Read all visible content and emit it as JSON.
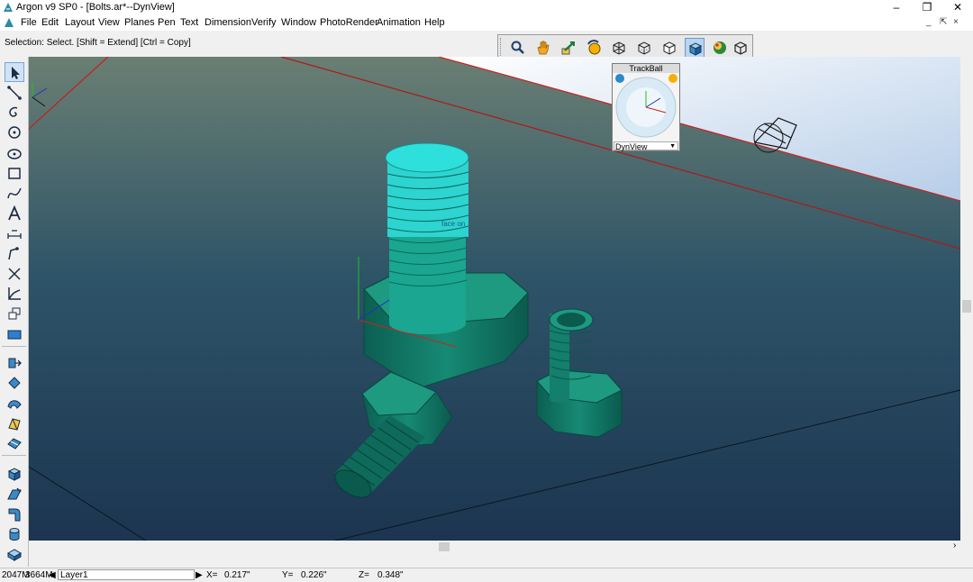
{
  "window": {
    "title": "Argon v9 SP0 - [Bolts.ar*--DynView]"
  },
  "menu": [
    "File",
    "Edit",
    "Layout",
    "View",
    "Planes",
    "Pen",
    "Text",
    "Dimension",
    "Verify",
    "Window",
    "PhotoRender",
    "Animation",
    "Help"
  ],
  "selection_hint": "Selection: Select. [Shift = Extend] [Ctrl = Copy]",
  "view_toolbar": [
    {
      "name": "zoom-icon"
    },
    {
      "name": "pan-hand-icon"
    },
    {
      "name": "zoom-window-icon"
    },
    {
      "name": "rotate-view-icon"
    },
    {
      "name": "wireframe-cube-icon"
    },
    {
      "name": "hidden-line-cube-icon"
    },
    {
      "name": "shaded-cube-icon"
    },
    {
      "name": "smooth-shaded-cube-icon",
      "active": true
    },
    {
      "name": "render-sphere-icon"
    },
    {
      "name": "outline-cube-icon"
    }
  ],
  "left_tools": [
    {
      "name": "select-arrow-icon",
      "active": true
    },
    {
      "name": "line-icon"
    },
    {
      "name": "spiral-icon"
    },
    {
      "name": "circle-icon"
    },
    {
      "name": "ellipse-icon"
    },
    {
      "name": "rectangle-icon"
    },
    {
      "name": "curve-icon"
    },
    {
      "name": "text-icon"
    },
    {
      "name": "dimension-icon"
    },
    {
      "name": "polyline-icon"
    },
    {
      "name": "trim-icon"
    },
    {
      "name": "axis-icon"
    },
    {
      "name": "transform-icon"
    },
    {
      "name": "filled-rectangle-icon"
    },
    {
      "name": "extrude-icon"
    },
    {
      "name": "revolve-icon"
    },
    {
      "name": "sweep-icon"
    },
    {
      "name": "loft-icon"
    },
    {
      "name": "skin-icon"
    },
    {
      "name": "box-solid-icon"
    },
    {
      "name": "chamfer-icon"
    },
    {
      "name": "bend-icon"
    },
    {
      "name": "cylinder-solid-icon"
    },
    {
      "name": "shell-solid-icon"
    }
  ],
  "trackball": {
    "title": "TrackBall",
    "view": "DynView"
  },
  "viewport": {
    "label": "face on",
    "bg_top": "#6a7f73",
    "bg_bottom": "#1c3550",
    "part_color": "#117a66",
    "highlight_color": "#29d6d6"
  },
  "status": {
    "memory_total": "2047M",
    "memory_free": "3664M",
    "layer": "Layer1",
    "x_label": "X=",
    "x_value": "0.217\"",
    "y_label": "Y=",
    "y_value": "0.226\"",
    "z_label": "Z=",
    "z_value": "0.348\""
  }
}
